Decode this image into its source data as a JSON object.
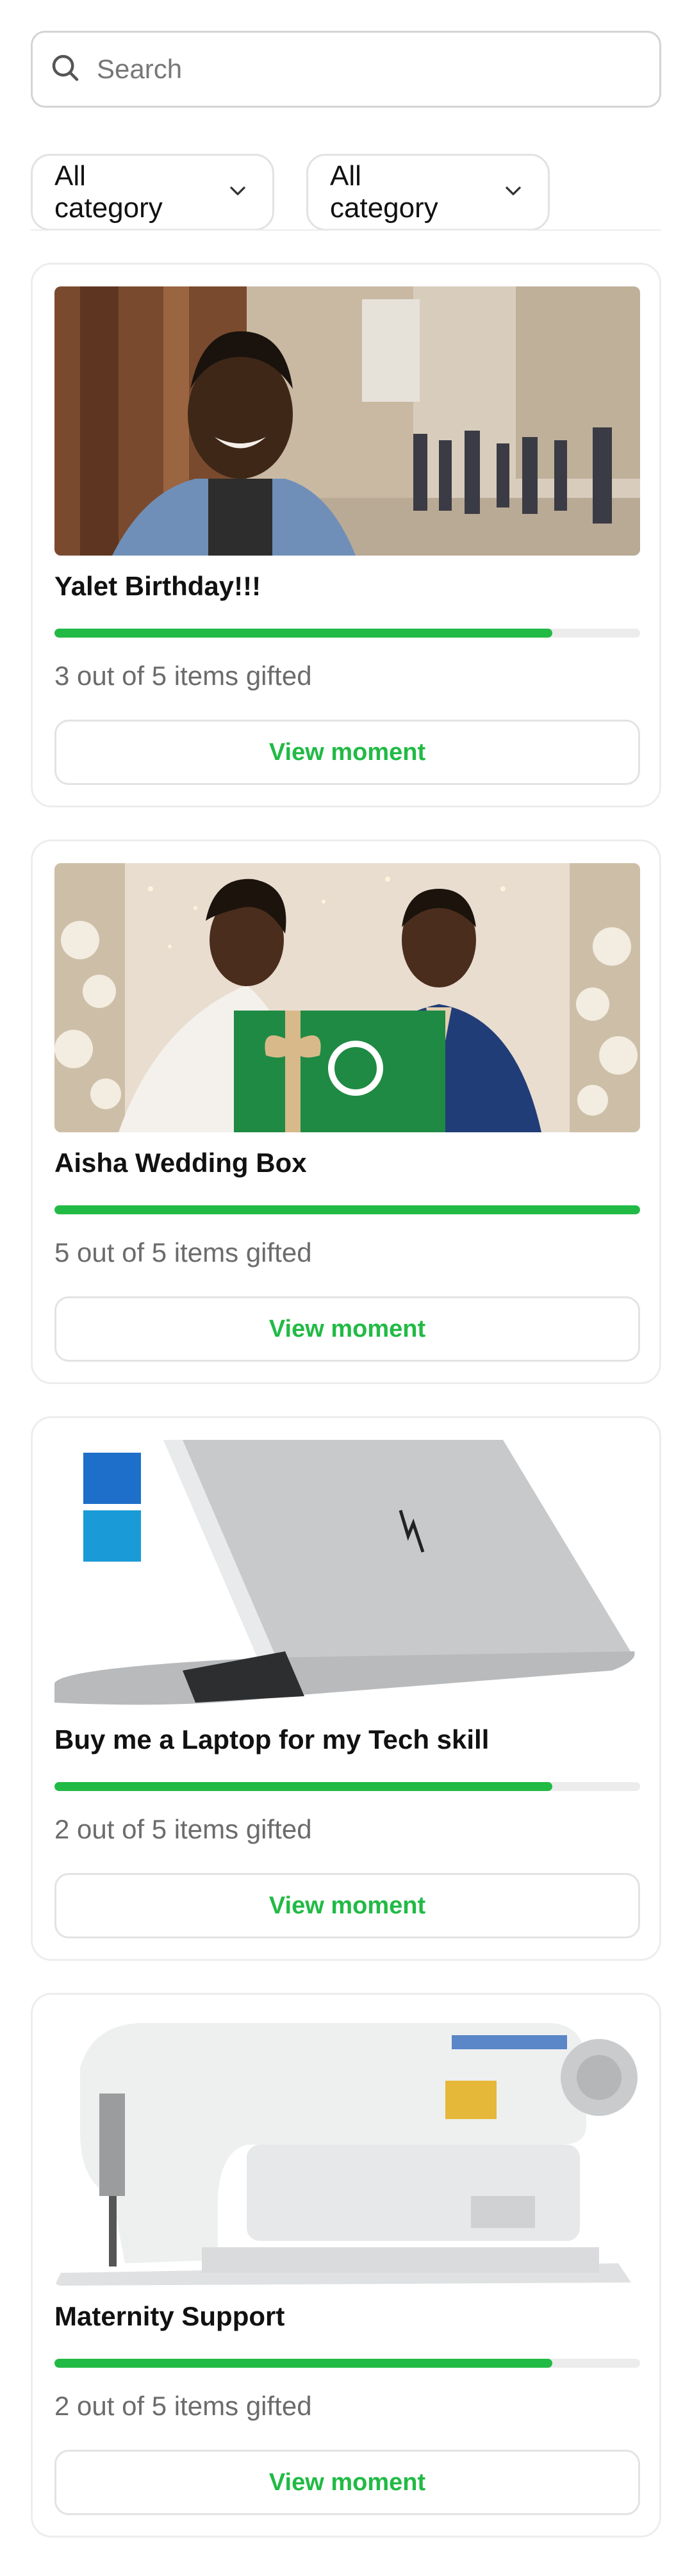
{
  "search": {
    "placeholder": "Search",
    "icon": "search-icon"
  },
  "filters": [
    {
      "label": "All category",
      "icon": "chevron-down-icon"
    },
    {
      "label": "All category",
      "icon": "chevron-down-icon"
    }
  ],
  "colors": {
    "accent": "#21ba45",
    "track": "#ececec",
    "border": "#e3e3e3"
  },
  "cards": [
    {
      "title": "Yalet Birthday!!!",
      "status": "3 out of 5 items gifted",
      "progress": 0.85,
      "button": "View moment",
      "image": "smiling-man-street-photo"
    },
    {
      "title": "Aisha Wedding Box",
      "status": "5 out of 5 items gifted",
      "progress": 1.0,
      "button": "View moment",
      "image": "wedding-couple-gift-box-photo"
    },
    {
      "title": "Buy me a Laptop for my Tech skill",
      "status": "2 out of 5 items gifted",
      "progress": 0.85,
      "button": "View moment",
      "image": "laptop-photo"
    },
    {
      "title": "Maternity Support",
      "status": "2 out of 5 items gifted",
      "progress": 0.85,
      "button": "View moment",
      "image": "sewing-machine-photo"
    }
  ]
}
